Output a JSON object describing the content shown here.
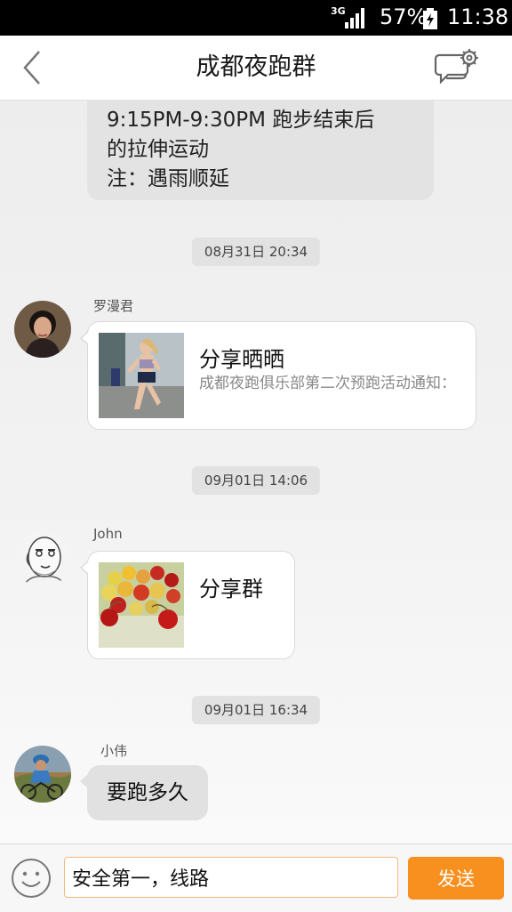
{
  "status_bar": {
    "network": "3G",
    "battery": "57%",
    "time": "11:38"
  },
  "header": {
    "title": "成都夜跑群",
    "back_icon": "chevron-left-icon",
    "settings_icon": "chat-settings-icon"
  },
  "previous_message": {
    "lines": [
      "9:15PM-9:30PM  跑步结束后",
      "的拉伸运动",
      "注：遇雨顺延"
    ]
  },
  "messages": [
    {
      "time": "08月31日 20:34",
      "sender": "罗漫君",
      "type": "share_card",
      "card_title": "分享晒晒",
      "card_desc": "成都夜跑俱乐部第二次预跑活动通知："
    },
    {
      "time": "09月01日 14:06",
      "sender": "John",
      "type": "share_card",
      "card_title": "分享群",
      "card_desc": ""
    },
    {
      "time": "09月01日 16:34",
      "sender": "小伟",
      "type": "text",
      "text": "要跑多久"
    }
  ],
  "input_bar": {
    "emoji_icon": "smiley-icon",
    "input_value": "安全第一，线路",
    "send_label": "发送"
  },
  "colors": {
    "accent": "#f7901e",
    "input_border": "#f0b97c",
    "status_bar": "#000000"
  }
}
